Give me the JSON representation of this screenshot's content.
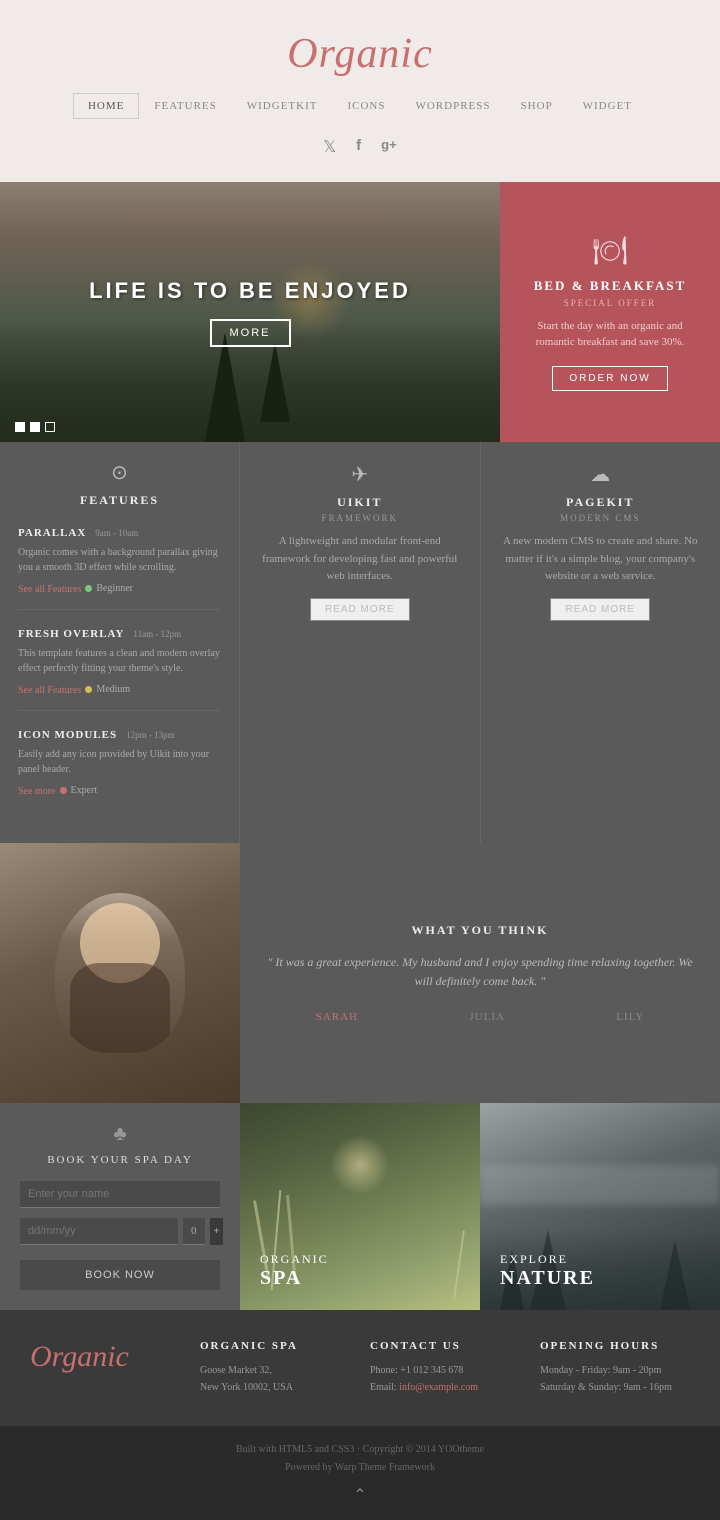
{
  "site": {
    "title": "Organic",
    "footer_title": "Organic"
  },
  "nav": {
    "items": [
      {
        "label": "HOME",
        "active": true
      },
      {
        "label": "FEATURES",
        "active": false
      },
      {
        "label": "WIDGETKIT",
        "active": false
      },
      {
        "label": "ICONS",
        "active": false
      },
      {
        "label": "WORDPRESS",
        "active": false
      },
      {
        "label": "SHOP",
        "active": false
      },
      {
        "label": "WIDGET",
        "active": false
      }
    ]
  },
  "social": {
    "twitter": "𝕏",
    "facebook": "f",
    "googleplus": "g+"
  },
  "hero": {
    "title": "LIFE IS TO BE ENJOYED",
    "button": "MORE"
  },
  "promo": {
    "icon": "🍽",
    "title": "BED & BREAKFAST",
    "subtitle": "SPECIAL OFFER",
    "description": "Start the day with an organic and romantic breakfast and save 30%.",
    "button": "ORDER NOW"
  },
  "features": {
    "left": {
      "icon": "⊙",
      "name": "FEATURES",
      "items": [
        {
          "title": "PARALLAX",
          "time": "9am - 10am",
          "desc": "Organic comes with a background parallax giving you a smooth 3D effect while scrolling.",
          "link": "See all Features",
          "badge": "Beginner",
          "badge_color": "green"
        },
        {
          "title": "FRESH OVERLAY",
          "time": "11am - 12pm",
          "desc": "This template features a clean and modern overlay effect perfectly fitting your theme's style.",
          "link": "See all Features",
          "badge": "Medium",
          "badge_color": "yellow"
        },
        {
          "title": "ICON MODULES",
          "time": "12pm - 13pm",
          "desc": "Easily add any icon provided by Uikit into your panel header.",
          "link": "See more",
          "badge": "Expert",
          "badge_color": "red"
        }
      ]
    },
    "uikit": {
      "icon": "✈",
      "name": "UIKIT",
      "subtitle": "FRAMEWORK",
      "description": "A lightweight and modular front-end framework for developing fast and powerful web interfaces.",
      "button": "READ MORE"
    },
    "pagekit": {
      "icon": "☁",
      "name": "PAGEKIT",
      "subtitle": "MODERN CMS",
      "description": "A new modern CMS to create and share. No matter if it's a simple blog, your company's website or a web service.",
      "button": "READ MORE"
    }
  },
  "review": {
    "title": "WHAT YOU THINK",
    "text": "\" It was a great experience. My husband and I enjoy spending time relaxing together. We will definitely come back. \"",
    "names": [
      "SARAH",
      "JULIA",
      "LILY"
    ],
    "active": "SARAH"
  },
  "spa_booking": {
    "icon": "♣",
    "title": "BOOK YOUR SPA DAY",
    "name_placeholder": "Enter your name",
    "date_placeholder": "dd/mm/yy",
    "guests_value": "0",
    "button": "BOOK NOW"
  },
  "nature_cards": [
    {
      "label": "ORGANIC",
      "title": "SPA"
    },
    {
      "label": "EXPLORE",
      "title": "NATURE"
    }
  ],
  "footer": {
    "organic_spa": {
      "title": "ORGANIC SPA",
      "address": "Goose Market 32,\nNew York 10002, USA"
    },
    "contact": {
      "title": "CONTACT US",
      "phone": "Phone: +1 012 345 678",
      "email": "Email: info@example.com"
    },
    "hours": {
      "title": "OPENING HOURS",
      "weekday": "Monday - Friday: 9am - 20pm",
      "weekend": "Saturday & Sunday: 9am - 16pm"
    }
  },
  "footer_bottom": {
    "line1": "Built with HTML5 and CSS3 · Copyright © 2014 YOOtheme",
    "line2": "Powered by Warp Theme Framework"
  }
}
